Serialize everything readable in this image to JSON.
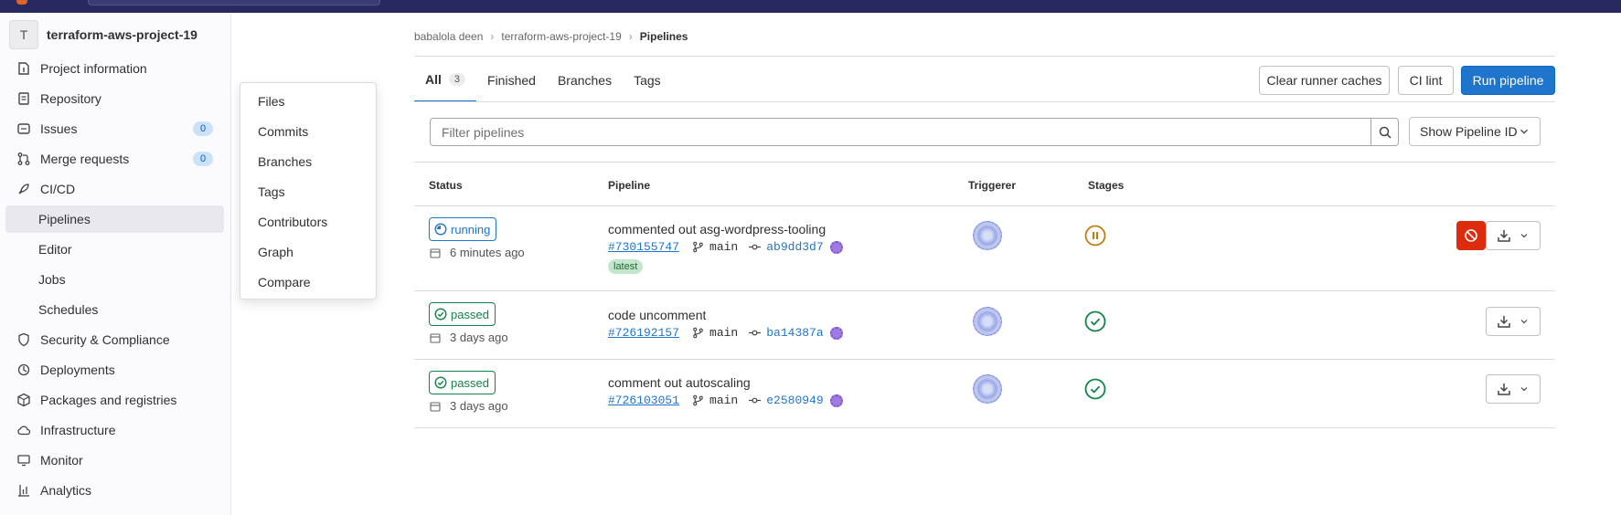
{
  "project": {
    "avatar_letter": "T",
    "name": "terraform-aws-project-19"
  },
  "sidebar": {
    "items": [
      {
        "label": "Project information",
        "icon": "info-icon"
      },
      {
        "label": "Repository",
        "icon": "document-icon"
      },
      {
        "label": "Issues",
        "icon": "issues-icon",
        "count": "0"
      },
      {
        "label": "Merge requests",
        "icon": "merge-request-icon",
        "count": "0"
      },
      {
        "label": "CI/CD",
        "icon": "rocket-icon"
      },
      {
        "label": "Pipelines",
        "active": true
      },
      {
        "label": "Editor"
      },
      {
        "label": "Jobs"
      },
      {
        "label": "Schedules"
      },
      {
        "label": "Security & Compliance",
        "icon": "shield-icon"
      },
      {
        "label": "Deployments",
        "icon": "deployments-icon"
      },
      {
        "label": "Packages and registries",
        "icon": "package-icon"
      },
      {
        "label": "Infrastructure",
        "icon": "cloud-icon"
      },
      {
        "label": "Monitor",
        "icon": "monitor-icon"
      },
      {
        "label": "Analytics",
        "icon": "chart-icon"
      }
    ]
  },
  "flyout": {
    "items": [
      "Files",
      "Commits",
      "Branches",
      "Tags",
      "Contributors",
      "Graph",
      "Compare"
    ]
  },
  "breadcrumb": {
    "items": [
      "babalola deen",
      "terraform-aws-project-19",
      "Pipelines"
    ]
  },
  "tabs": [
    {
      "label": "All",
      "count": "3",
      "active": true
    },
    {
      "label": "Finished"
    },
    {
      "label": "Branches"
    },
    {
      "label": "Tags"
    }
  ],
  "actions": {
    "clear_caches": "Clear runner caches",
    "ci_lint": "CI lint",
    "run_pipeline": "Run pipeline"
  },
  "filter": {
    "placeholder": "Filter pipelines",
    "show_pipeline_id": "Show Pipeline ID"
  },
  "table": {
    "headers": {
      "status": "Status",
      "pipeline": "Pipeline",
      "triggerer": "Triggerer",
      "stages": "Stages"
    },
    "rows": [
      {
        "status": "running",
        "time": "6 minutes ago",
        "title": "commented out asg-wordpress-tooling",
        "id": "#730155747",
        "branch": "main",
        "sha": "ab9dd3d7",
        "latest": "latest"
      },
      {
        "status": "passed",
        "time": "3 days ago",
        "title": "code uncomment",
        "id": "#726192157",
        "branch": "main",
        "sha": "ba14387a"
      },
      {
        "status": "passed",
        "time": "3 days ago",
        "title": "comment out autoscaling",
        "id": "#726103051",
        "branch": "main",
        "sha": "e2580949"
      }
    ]
  },
  "colors": {
    "accent": "#1f75cb",
    "success": "#108548",
    "danger": "#dd2b0e",
    "warning": "#c17d10",
    "topbar": "#292961"
  }
}
